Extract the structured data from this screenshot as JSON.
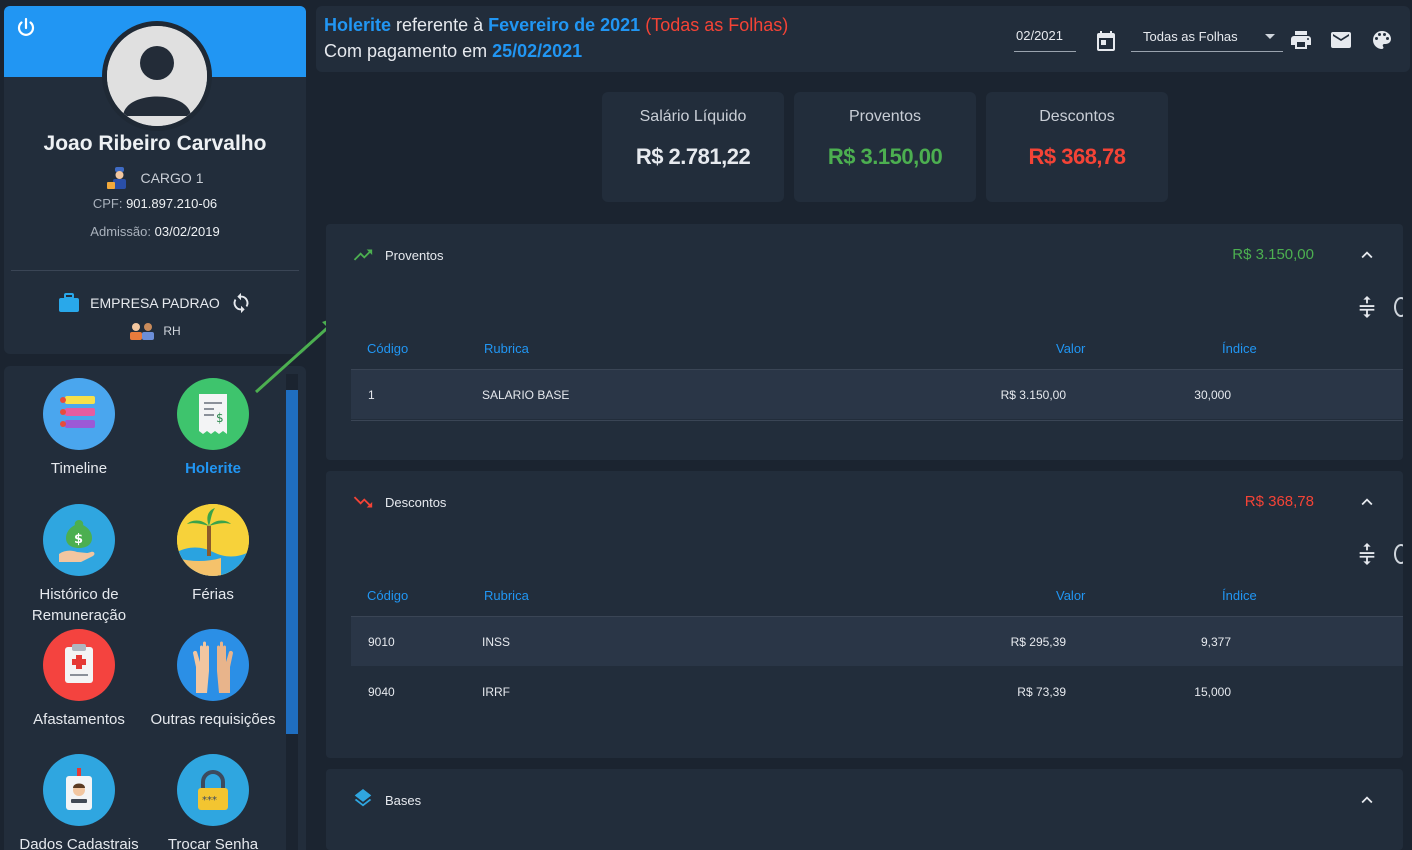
{
  "profile": {
    "name": "Joao Ribeiro Carvalho",
    "cargo": "CARGO 1",
    "cpf_label": "CPF:",
    "cpf": "901.897.210-06",
    "admissao_label": "Admissão:",
    "admissao": "03/02/2019",
    "empresa": "EMPRESA PADRAO",
    "departamento": "RH"
  },
  "menu": {
    "items": [
      {
        "label": "Timeline",
        "icon": "timeline-icon"
      },
      {
        "label": "Holerite",
        "icon": "receipt-icon",
        "active": true
      },
      {
        "label": "Histórico de Remuneração",
        "icon": "money-hand-icon"
      },
      {
        "label": "Férias",
        "icon": "beach-icon"
      },
      {
        "label": "Afastamentos",
        "icon": "medical-clipboard-icon"
      },
      {
        "label": "Outras requisições",
        "icon": "raised-hands-icon"
      },
      {
        "label": "Dados Cadastrais",
        "icon": "id-badge-icon"
      },
      {
        "label": "Trocar Senha",
        "icon": "padlock-icon"
      }
    ]
  },
  "header": {
    "holerite": "Holerite",
    "referente": " referente à ",
    "periodo": "Fevereiro de 2021",
    "folhas_tag": "(Todas as Folhas)",
    "pagamento_prefix": "Com pagamento em ",
    "pagamento_data": "25/02/2021",
    "date_value": "02/2021",
    "select_value": "Todas as Folhas"
  },
  "summary": [
    {
      "title": "Salário Líquido",
      "value": "R$ 2.781,22",
      "color": "#e6e9ee"
    },
    {
      "title": "Proventos",
      "value": "R$ 3.150,00",
      "color": "#4caf50"
    },
    {
      "title": "Descontos",
      "value": "R$ 368,78",
      "color": "#f44336"
    }
  ],
  "proventos": {
    "title": "Proventos",
    "total": "R$ 3.150,00",
    "color": "#4caf50",
    "columns": [
      "Código",
      "Rubrica",
      "Valor",
      "Índice"
    ],
    "rows": [
      {
        "codigo": "1",
        "rubrica": "SALARIO BASE",
        "valor": "R$ 3.150,00",
        "indice": "30,000"
      }
    ]
  },
  "descontos": {
    "title": "Descontos",
    "total": "R$ 368,78",
    "color": "#f44336",
    "columns": [
      "Código",
      "Rubrica",
      "Valor",
      "Índice"
    ],
    "rows": [
      {
        "codigo": "9010",
        "rubrica": "INSS",
        "valor": "R$ 295,39",
        "indice": "9,377"
      },
      {
        "codigo": "9040",
        "rubrica": "IRRF",
        "valor": "R$ 73,39",
        "indice": "15,000"
      }
    ]
  },
  "bases": {
    "title": "Bases"
  }
}
